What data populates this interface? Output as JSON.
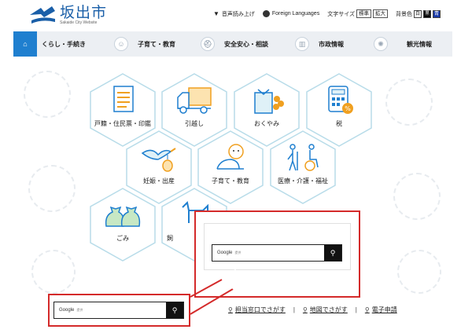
{
  "site": {
    "title": "坂出市",
    "subtitle": "Sakaide City Website"
  },
  "utilities": {
    "voice_label": "音声読み上げ",
    "languages_label": "Foreign Languages",
    "text_size_label": "文字サイズ",
    "text_size_standard": "標準",
    "text_size_large": "拡大",
    "bg_color_label": "背景色",
    "bg_white": "白",
    "bg_black": "黒",
    "bg_blue": "青"
  },
  "nav": {
    "items": [
      {
        "label": "くらし・手続き",
        "icon": "home-icon"
      },
      {
        "label": "子育て・教育",
        "icon": "child-icon"
      },
      {
        "label": "安全安心・相談",
        "icon": "helmet-icon"
      },
      {
        "label": "市政情報",
        "icon": "building-icon"
      },
      {
        "label": "観光情報",
        "icon": "sun-icon"
      }
    ]
  },
  "tiles": [
    {
      "label": "戸籍・住民票・印鑑",
      "icon": "document-icon"
    },
    {
      "label": "引越し",
      "icon": "truck-icon"
    },
    {
      "label": "おくやみ",
      "icon": "flower-icon"
    },
    {
      "label": "税",
      "icon": "calculator-icon"
    },
    {
      "label": "妊娠・出産",
      "icon": "stork-icon"
    },
    {
      "label": "子育て・教育",
      "icon": "baby-icon"
    },
    {
      "label": "医療・介護・福祉",
      "icon": "wheelchair-icon"
    },
    {
      "label": "ごみ",
      "icon": "garbage-bag-icon"
    },
    {
      "label": "飼",
      "icon": "dog-icon"
    }
  ],
  "search": {
    "brand": "Google",
    "brand_note": "提供"
  },
  "links": [
    {
      "label": "担当窓口でさがす"
    },
    {
      "label": "地図でさがす"
    },
    {
      "label": "電子申請"
    }
  ],
  "colors": {
    "accent": "#1f7fcf",
    "highlight": "#d42a2a",
    "tile_border": "#b8dce9"
  }
}
